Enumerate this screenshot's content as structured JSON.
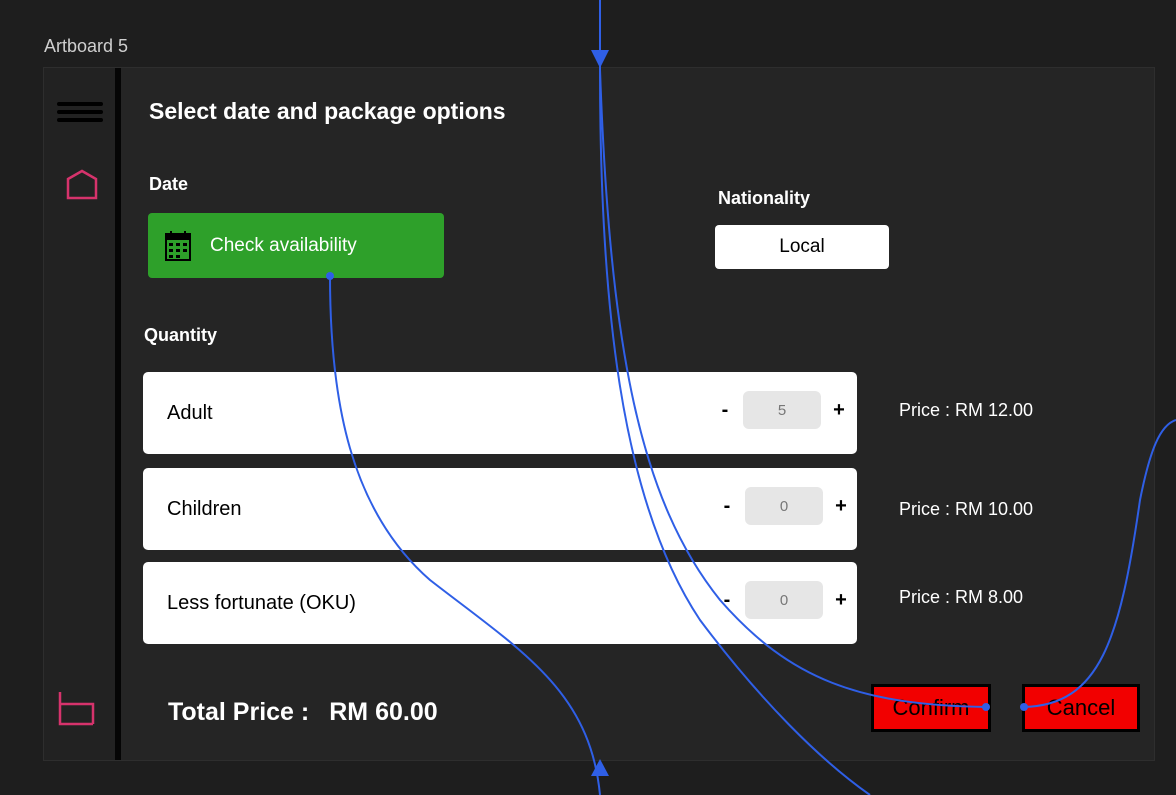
{
  "artboard": {
    "label": "Artboard 5"
  },
  "sidebar": {
    "menu_icon": "menu-icon",
    "home_icon": "home-icon",
    "cart_icon": "cart-icon",
    "accent": "#d6336c"
  },
  "header": {
    "title": "Select date and package options"
  },
  "date": {
    "label": "Date",
    "button_label": "Check availability",
    "icon": "calendar-icon",
    "button_color": "#2ea02a"
  },
  "nationality": {
    "label": "Nationality",
    "value": "Local"
  },
  "quantity": {
    "label": "Quantity",
    "items": [
      {
        "name": "Adult",
        "minus": "-",
        "value": "5",
        "plus": "+",
        "price": "Price : RM 12.00"
      },
      {
        "name": "Children",
        "minus": "-",
        "value": "0",
        "plus": "+",
        "price": "Price : RM 10.00"
      },
      {
        "name": "Less fortunate (OKU)",
        "minus": "-",
        "value": "0",
        "plus": "+",
        "price": "Price : RM 8.00"
      }
    ]
  },
  "total": {
    "label": "Total Price :",
    "value": "RM 60.00"
  },
  "actions": {
    "confirm_label": "Confirm",
    "cancel_label": "Cancel",
    "button_color": "#f20000"
  },
  "prototype_links": {
    "color": "#2f5fe6"
  }
}
